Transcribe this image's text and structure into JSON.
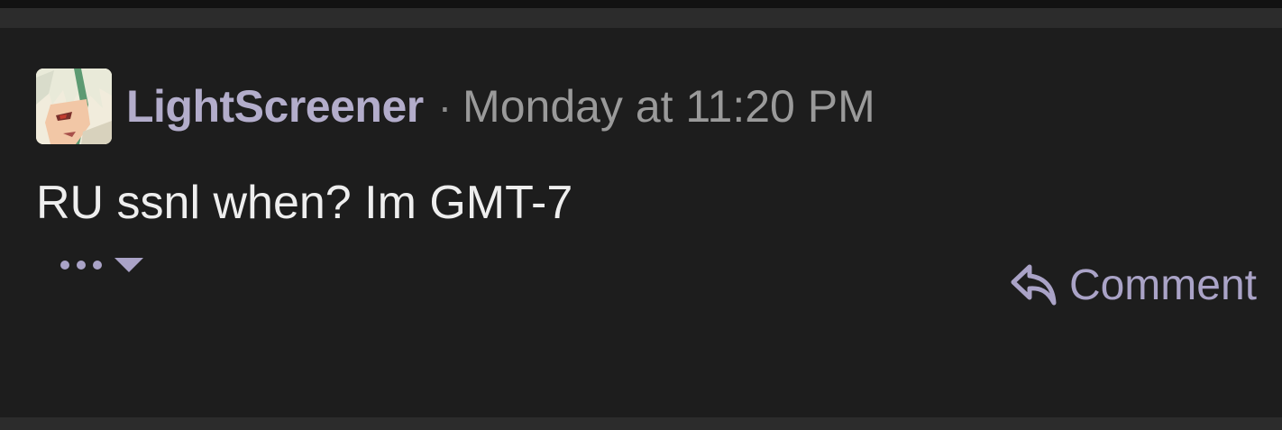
{
  "post": {
    "author": "LightScreener",
    "separator": "·",
    "timestamp": "Monday at 11:20 PM",
    "message": "RU ssnl when? Im GMT-7"
  },
  "actions": {
    "more_icon": "ellipsis-icon",
    "dropdown_icon": "caret-down-icon",
    "comment_icon": "reply-arrow-icon",
    "comment_label": "Comment"
  },
  "colors": {
    "background": "#1d1d1d",
    "band": "#2c2c2c",
    "author": "#b3adcb",
    "accent": "#aaa3c7",
    "muted_text": "#9a9a9a",
    "body_text": "#eeeeee"
  }
}
